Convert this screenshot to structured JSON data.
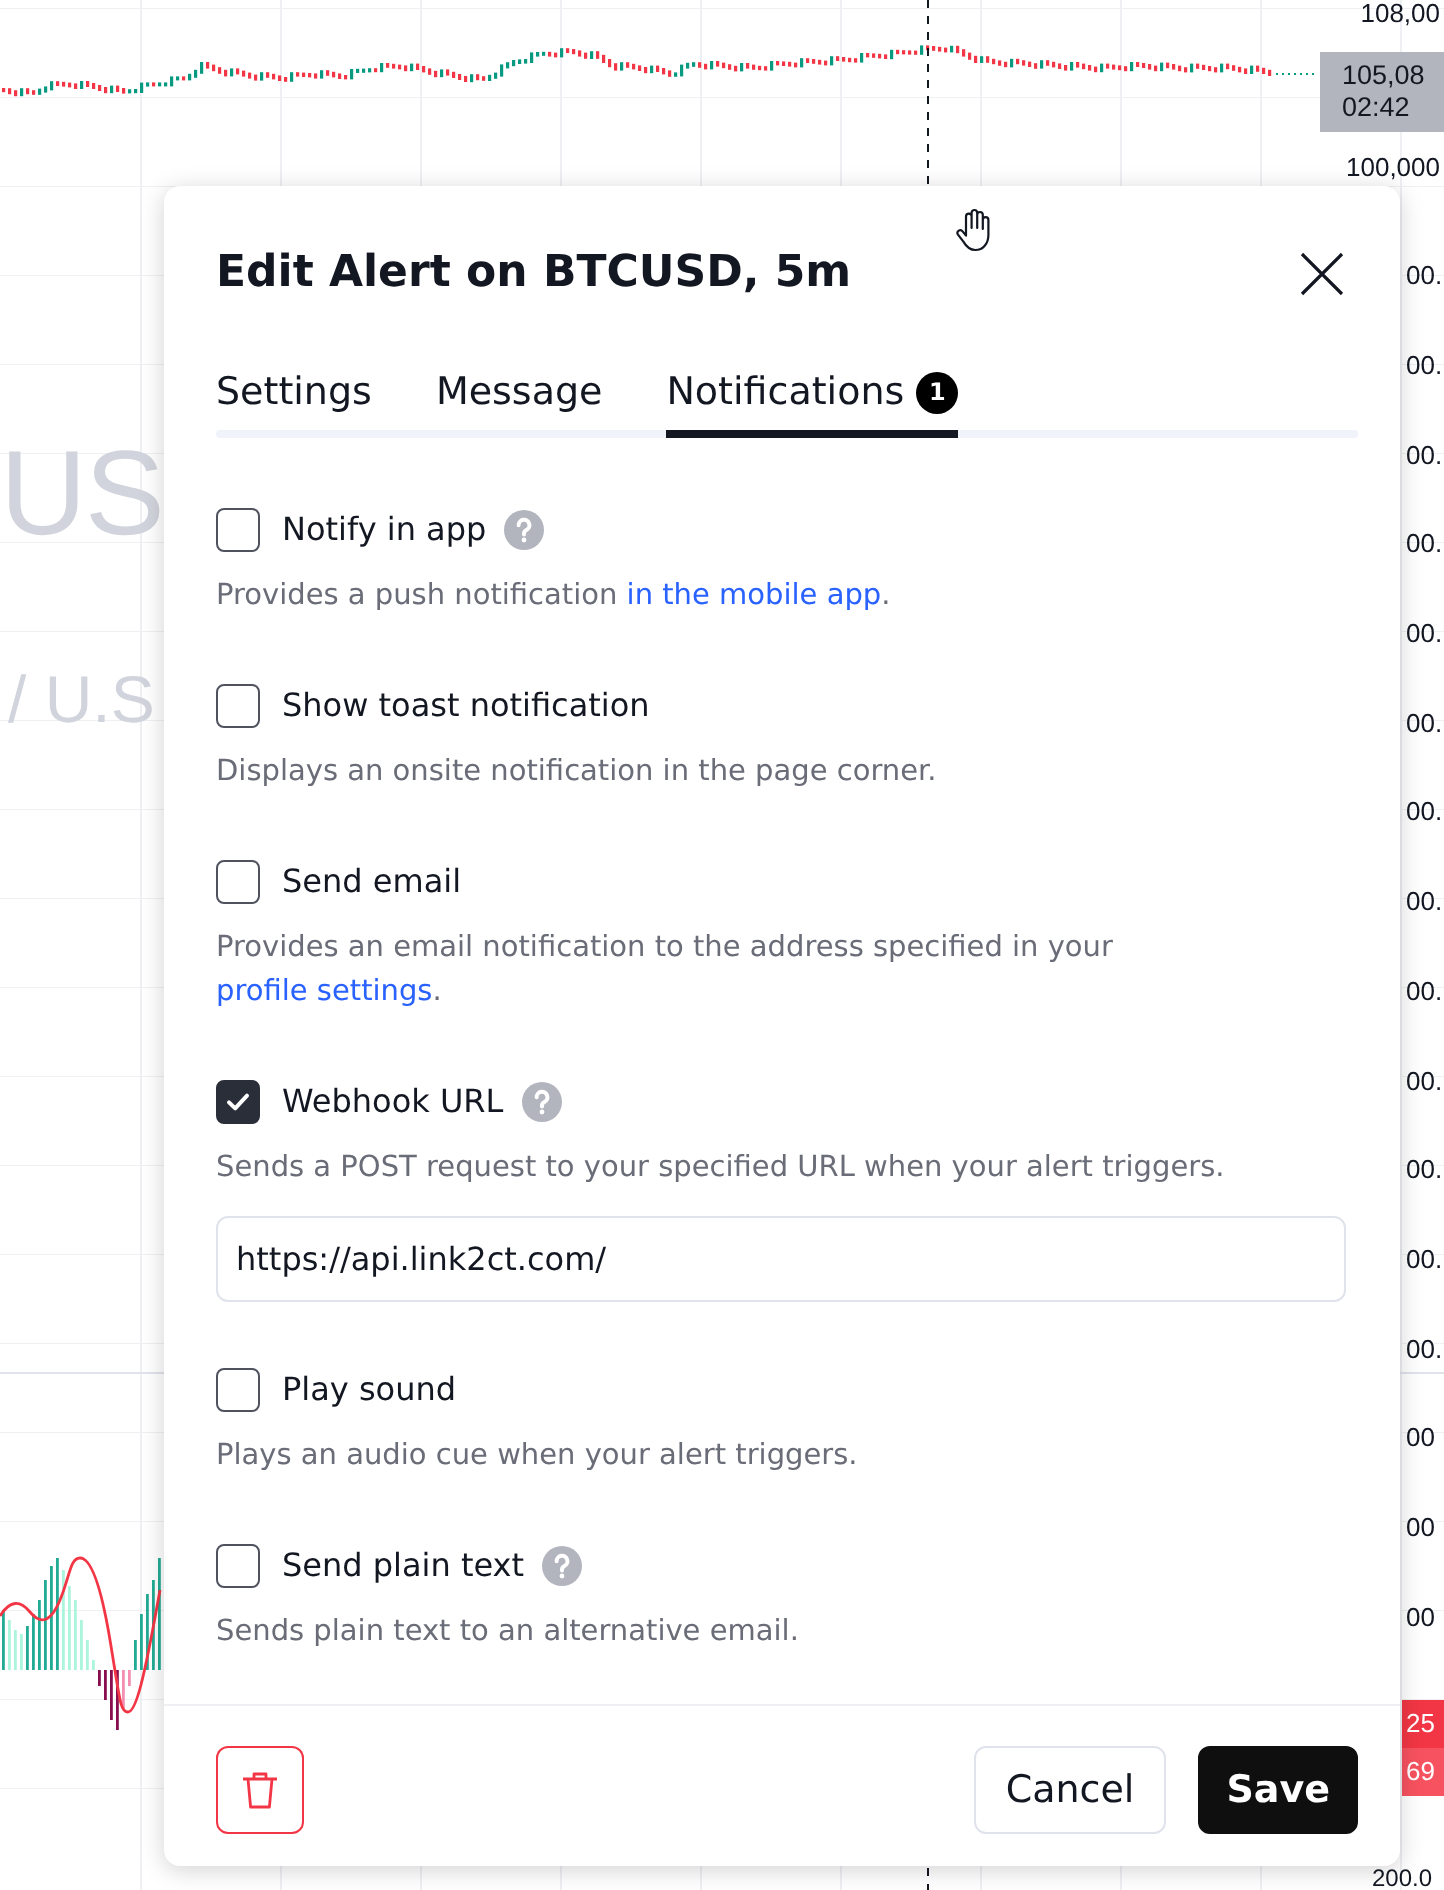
{
  "chart": {
    "watermark": {
      "symbol": "US",
      "description": "/ U.S"
    },
    "price_scale": {
      "top_label": "108,00",
      "price_tag": {
        "price": "105,08",
        "countdown": "02:42"
      },
      "upper_label": "100,000",
      "labels": [
        "00.",
        "00.",
        "00.",
        "00.",
        "00.",
        "00.",
        "00.",
        "00.",
        "00.",
        "00.",
        "00.",
        "00.",
        "00."
      ]
    },
    "indicator_scale": {
      "labels": [
        "00",
        "00",
        "00"
      ],
      "value_tags": [
        {
          "text": "25",
          "color": "#f23645"
        },
        {
          "text": "69",
          "color": "#f7525f"
        }
      ],
      "bottom_label": "200.0"
    }
  },
  "dialog": {
    "title": "Edit Alert on BTCUSD, 5m",
    "tabs": [
      {
        "label": "Settings",
        "selected": false
      },
      {
        "label": "Message",
        "selected": false
      },
      {
        "label": "Notifications",
        "selected": true,
        "badge": "1"
      }
    ],
    "options": [
      {
        "label": "Notify in app",
        "checked": false,
        "help": true,
        "description": [
          {
            "text": "Provides a push notification ",
            "link": false
          },
          {
            "text": "in the mobile app",
            "link": true
          },
          {
            "text": ".",
            "link": false
          }
        ]
      },
      {
        "label": "Show toast notification",
        "checked": false,
        "help": false,
        "description": [
          {
            "text": "Displays an onsite notification in the page corner.",
            "link": false
          }
        ]
      },
      {
        "label": "Send email",
        "checked": false,
        "help": false,
        "description": [
          {
            "text": "Provides an email notification to the address specified in your ",
            "link": false
          },
          {
            "text": "profile settings",
            "link": true
          },
          {
            "text": ".",
            "link": false
          }
        ]
      },
      {
        "label": "Webhook URL",
        "checked": true,
        "help": true,
        "description": [
          {
            "text": "Sends a POST request to your specified URL when your alert triggers.",
            "link": false
          }
        ],
        "url_field": {
          "value": "https://api.link2ct.com/"
        }
      },
      {
        "label": "Play sound",
        "checked": false,
        "help": false,
        "description": [
          {
            "text": "Plays an audio cue when your alert triggers.",
            "link": false
          }
        ]
      },
      {
        "label": "Send plain text",
        "checked": false,
        "help": true,
        "description": [
          {
            "text": "Sends plain text to an alternative email.",
            "link": false
          }
        ]
      }
    ],
    "buttons": [
      {
        "label": "Cancel",
        "kind": "secondary"
      },
      {
        "label": "Save",
        "kind": "primary"
      }
    ]
  }
}
